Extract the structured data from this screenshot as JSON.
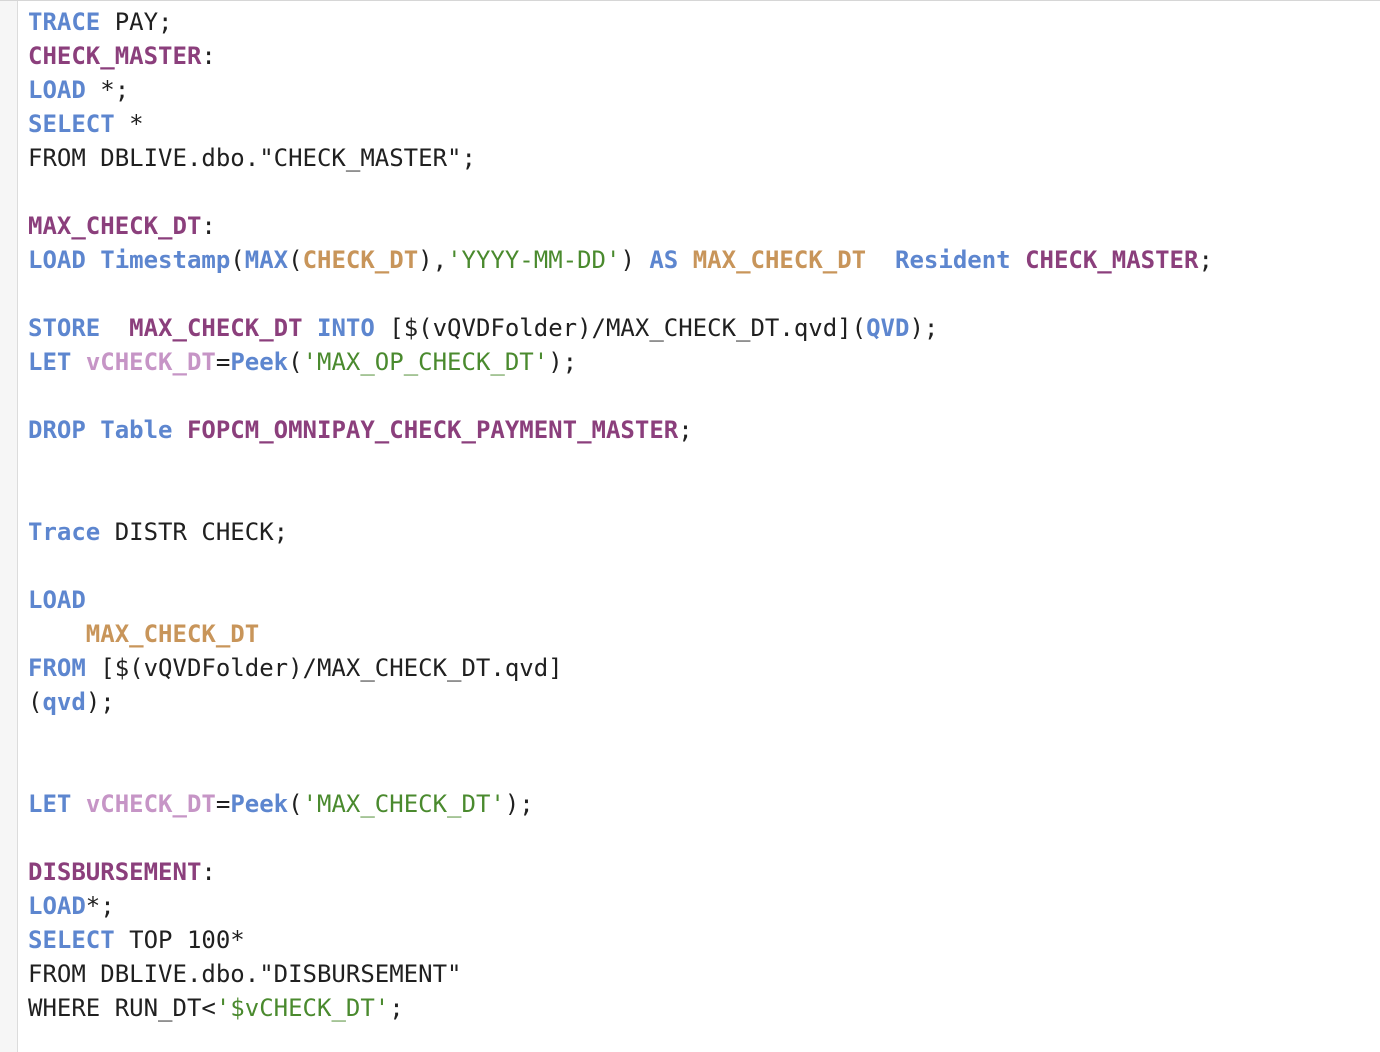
{
  "editor": {
    "lines": [
      [
        {
          "t": "TRACE",
          "c": "kw"
        },
        {
          "t": " PAY;",
          "c": "pl"
        }
      ],
      [
        {
          "t": "CHECK_MASTER",
          "c": "lbl"
        },
        {
          "t": ":",
          "c": "pl"
        }
      ],
      [
        {
          "t": "LOAD",
          "c": "kw"
        },
        {
          "t": " *;",
          "c": "pl"
        }
      ],
      [
        {
          "t": "SELECT",
          "c": "kw"
        },
        {
          "t": " *",
          "c": "pl"
        }
      ],
      [
        {
          "t": "FROM DBLIVE.dbo.\"CHECK_MASTER\";",
          "c": "pl"
        }
      ],
      [],
      [
        {
          "t": "MAX_CHECK_DT",
          "c": "lbl"
        },
        {
          "t": ":",
          "c": "pl"
        }
      ],
      [
        {
          "t": "LOAD",
          "c": "kw"
        },
        {
          "t": " ",
          "c": "pl"
        },
        {
          "t": "Timestamp",
          "c": "kw"
        },
        {
          "t": "(",
          "c": "pl"
        },
        {
          "t": "MAX",
          "c": "kw"
        },
        {
          "t": "(",
          "c": "pl"
        },
        {
          "t": "CHECK_DT",
          "c": "fld"
        },
        {
          "t": "),",
          "c": "pl"
        },
        {
          "t": "'YYYY-MM-DD'",
          "c": "str"
        },
        {
          "t": ") ",
          "c": "pl"
        },
        {
          "t": "AS",
          "c": "kw"
        },
        {
          "t": " ",
          "c": "pl"
        },
        {
          "t": "MAX_CHECK_DT",
          "c": "fld"
        },
        {
          "t": "  ",
          "c": "pl"
        },
        {
          "t": "Resident",
          "c": "kw"
        },
        {
          "t": " ",
          "c": "pl"
        },
        {
          "t": "CHECK_MASTER",
          "c": "lbl"
        },
        {
          "t": ";",
          "c": "pl"
        }
      ],
      [],
      [
        {
          "t": "STORE",
          "c": "kw"
        },
        {
          "t": "  ",
          "c": "pl"
        },
        {
          "t": "MAX_CHECK_DT",
          "c": "lbl"
        },
        {
          "t": " ",
          "c": "pl"
        },
        {
          "t": "INTO",
          "c": "kw"
        },
        {
          "t": " [$(vQVDFolder)/MAX_CHECK_DT.qvd](",
          "c": "pl"
        },
        {
          "t": "QVD",
          "c": "kw"
        },
        {
          "t": ");",
          "c": "pl"
        }
      ],
      [
        {
          "t": "LET",
          "c": "kw"
        },
        {
          "t": " ",
          "c": "pl"
        },
        {
          "t": "vCHECK_DT",
          "c": "var"
        },
        {
          "t": "=",
          "c": "pl"
        },
        {
          "t": "Peek",
          "c": "kw"
        },
        {
          "t": "(",
          "c": "pl"
        },
        {
          "t": "'MAX_OP_CHECK_DT'",
          "c": "str"
        },
        {
          "t": ");",
          "c": "pl"
        }
      ],
      [],
      [
        {
          "t": "DROP",
          "c": "kw"
        },
        {
          "t": " ",
          "c": "pl"
        },
        {
          "t": "Table",
          "c": "kw"
        },
        {
          "t": " ",
          "c": "pl"
        },
        {
          "t": "FOPCM_OMNIPAY_CHECK_PAYMENT_MASTER",
          "c": "lbl"
        },
        {
          "t": ";",
          "c": "pl"
        }
      ],
      [],
      [],
      [
        {
          "t": "Trace",
          "c": "kw"
        },
        {
          "t": " DISTR CHECK;",
          "c": "pl"
        }
      ],
      [],
      [
        {
          "t": "LOAD",
          "c": "kw"
        }
      ],
      [
        {
          "t": "    ",
          "c": "pl"
        },
        {
          "t": "MAX_CHECK_DT",
          "c": "fld"
        }
      ],
      [
        {
          "t": "FROM",
          "c": "kw"
        },
        {
          "t": " [$(vQVDFolder)/MAX_CHECK_DT.qvd]",
          "c": "pl"
        }
      ],
      [
        {
          "t": "(",
          "c": "pl"
        },
        {
          "t": "qvd",
          "c": "kw"
        },
        {
          "t": ");",
          "c": "pl"
        }
      ],
      [],
      [],
      [
        {
          "t": "LET",
          "c": "kw"
        },
        {
          "t": " ",
          "c": "pl"
        },
        {
          "t": "vCHECK_DT",
          "c": "var"
        },
        {
          "t": "=",
          "c": "pl"
        },
        {
          "t": "Peek",
          "c": "kw"
        },
        {
          "t": "(",
          "c": "pl"
        },
        {
          "t": "'MAX_CHECK_DT'",
          "c": "str"
        },
        {
          "t": ");",
          "c": "pl"
        }
      ],
      [],
      [
        {
          "t": "DISBURSEMENT",
          "c": "lbl"
        },
        {
          "t": ":",
          "c": "pl"
        }
      ],
      [
        {
          "t": "LOAD",
          "c": "kw"
        },
        {
          "t": "*;",
          "c": "pl"
        }
      ],
      [
        {
          "t": "SELECT",
          "c": "kw"
        },
        {
          "t": " TOP 100*",
          "c": "pl"
        }
      ],
      [
        {
          "t": "FROM DBLIVE.dbo.\"DISBURSEMENT\"",
          "c": "pl"
        }
      ],
      [
        {
          "t": "WHERE RUN_DT<",
          "c": "pl"
        },
        {
          "t": "'$vCHECK_DT'",
          "c": "str"
        },
        {
          "t": ";",
          "c": "pl"
        }
      ]
    ]
  },
  "colors": {
    "keyword": "#5d86cf",
    "label": "#8b3f7c",
    "field": "#c8955a",
    "variable": "#c695c6",
    "string": "#4a8a2e",
    "text": "#202020"
  }
}
